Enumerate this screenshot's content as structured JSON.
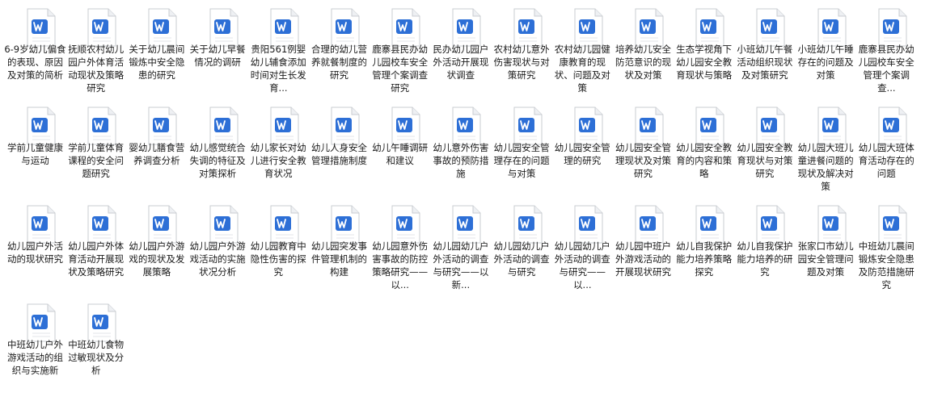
{
  "icon": "word-document-icon",
  "colors": {
    "accent": "#2d6fd6"
  },
  "files": [
    {
      "name": "6-9岁幼儿偏食的表现、原因及对策的简析"
    },
    {
      "name": "抚顺农村幼儿园户外体育活动现状及策略研究"
    },
    {
      "name": "关于幼儿晨间锻炼中安全隐患的研究"
    },
    {
      "name": "关于幼儿早餐情况的调研"
    },
    {
      "name": "贵阳561例婴幼儿辅食添加时间对生长发育..."
    },
    {
      "name": "合理的幼儿营养就餐制度的研究"
    },
    {
      "name": "鹿寨县民办幼儿园校车安全管理个案调查研究"
    },
    {
      "name": "民办幼儿园户外活动开展现状调查"
    },
    {
      "name": "农村幼儿意外伤害现状与对策研究"
    },
    {
      "name": "农村幼儿园健康教育的现状、问题及对策"
    },
    {
      "name": "培养幼儿安全防范意识的现状及对策"
    },
    {
      "name": "生态学视角下幼儿园安全教育现状与策略"
    },
    {
      "name": "小班幼儿午餐活动组织现状及对策研究"
    },
    {
      "name": "小班幼儿午睡存在的问题及对策"
    },
    {
      "name": "鹿寨县民办幼儿园校车安全管理个案调查..."
    },
    {
      "name": "学前儿童健康与运动"
    },
    {
      "name": "学前儿童体育课程的安全问题研究"
    },
    {
      "name": "婴幼儿膳食营养调查分析"
    },
    {
      "name": "幼儿感觉统合失调的特征及对策探析"
    },
    {
      "name": "幼儿家长对幼儿进行安全教育状况"
    },
    {
      "name": "幼儿人身安全管理措施制度"
    },
    {
      "name": "幼儿午睡调研和建议"
    },
    {
      "name": "幼儿意外伤害事故的预防措施"
    },
    {
      "name": "幼儿园安全管理存在的问题与对策"
    },
    {
      "name": "幼儿园安全管理的研究"
    },
    {
      "name": "幼儿园安全管理现状及对策研究"
    },
    {
      "name": "幼儿园安全教育的内容和策略"
    },
    {
      "name": "幼儿园安全教育现状与对策研究"
    },
    {
      "name": "幼儿园大班儿童进餐问题的现状及解决对策"
    },
    {
      "name": "幼儿园大班体育活动存在的问题"
    },
    {
      "name": "幼儿园户外活动的现状研究"
    },
    {
      "name": "幼儿园户外体育活动开展现状及策略研究"
    },
    {
      "name": "幼儿园户外游戏的现状及发展策略"
    },
    {
      "name": "幼儿园户外游戏活动的实施状况分析"
    },
    {
      "name": "幼儿园教育中隐性伤害的探究"
    },
    {
      "name": "幼儿园突发事件管理机制的构建"
    },
    {
      "name": "幼儿园意外伤害事故的防控策略研究——以..."
    },
    {
      "name": "幼儿园幼儿户外活动的调查与研究——以新..."
    },
    {
      "name": "幼儿园幼儿户外活动的调查与研究"
    },
    {
      "name": "幼儿园幼儿户外活动的调查与研究——以..."
    },
    {
      "name": "幼儿园中班户外游戏活动的开展现状研究"
    },
    {
      "name": "幼儿自我保护能力培养策略探究"
    },
    {
      "name": "幼儿自我保护能力培养的研究"
    },
    {
      "name": "张家口市幼儿园安全管理问题及对策"
    },
    {
      "name": "中班幼儿晨间锻炼安全隐患及防范措施研究"
    },
    {
      "name": "中班幼儿户外游戏活动的组织与实施新"
    },
    {
      "name": "中班幼儿食物过敏现状及分析"
    }
  ]
}
